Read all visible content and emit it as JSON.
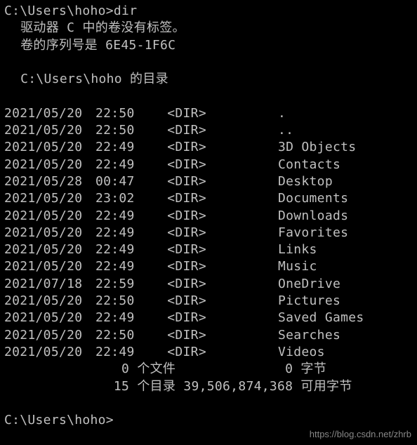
{
  "prompt1": "C:\\Users\\hoho>",
  "command": "dir",
  "header": {
    "volume_line": " 驱动器 C 中的卷没有标签。",
    "serial_line": " 卷的序列号是 6E45-1F6C",
    "dirof_line": " C:\\Users\\hoho 的目录"
  },
  "entries": [
    {
      "date": "2021/05/20",
      "time": "22:50",
      "type": "<DIR>",
      "name": "."
    },
    {
      "date": "2021/05/20",
      "time": "22:50",
      "type": "<DIR>",
      "name": ".."
    },
    {
      "date": "2021/05/20",
      "time": "22:49",
      "type": "<DIR>",
      "name": "3D Objects"
    },
    {
      "date": "2021/05/20",
      "time": "22:49",
      "type": "<DIR>",
      "name": "Contacts"
    },
    {
      "date": "2021/05/28",
      "time": "00:47",
      "type": "<DIR>",
      "name": "Desktop"
    },
    {
      "date": "2021/05/20",
      "time": "23:02",
      "type": "<DIR>",
      "name": "Documents"
    },
    {
      "date": "2021/05/20",
      "time": "22:49",
      "type": "<DIR>",
      "name": "Downloads"
    },
    {
      "date": "2021/05/20",
      "time": "22:49",
      "type": "<DIR>",
      "name": "Favorites"
    },
    {
      "date": "2021/05/20",
      "time": "22:49",
      "type": "<DIR>",
      "name": "Links"
    },
    {
      "date": "2021/05/20",
      "time": "22:49",
      "type": "<DIR>",
      "name": "Music"
    },
    {
      "date": "2021/07/18",
      "time": "22:59",
      "type": "<DIR>",
      "name": "OneDrive"
    },
    {
      "date": "2021/05/20",
      "time": "22:50",
      "type": "<DIR>",
      "name": "Pictures"
    },
    {
      "date": "2021/05/20",
      "time": "22:49",
      "type": "<DIR>",
      "name": "Saved Games"
    },
    {
      "date": "2021/05/20",
      "time": "22:50",
      "type": "<DIR>",
      "name": "Searches"
    },
    {
      "date": "2021/05/20",
      "time": "22:49",
      "type": "<DIR>",
      "name": "Videos"
    }
  ],
  "summary": {
    "files_line": "               0 个文件              0 字节",
    "dirs_line": "              15 个目录 39,506,874,368 可用字节"
  },
  "prompt2": "C:\\Users\\hoho>",
  "watermark": "https://blog.csdn.net/zhrb"
}
